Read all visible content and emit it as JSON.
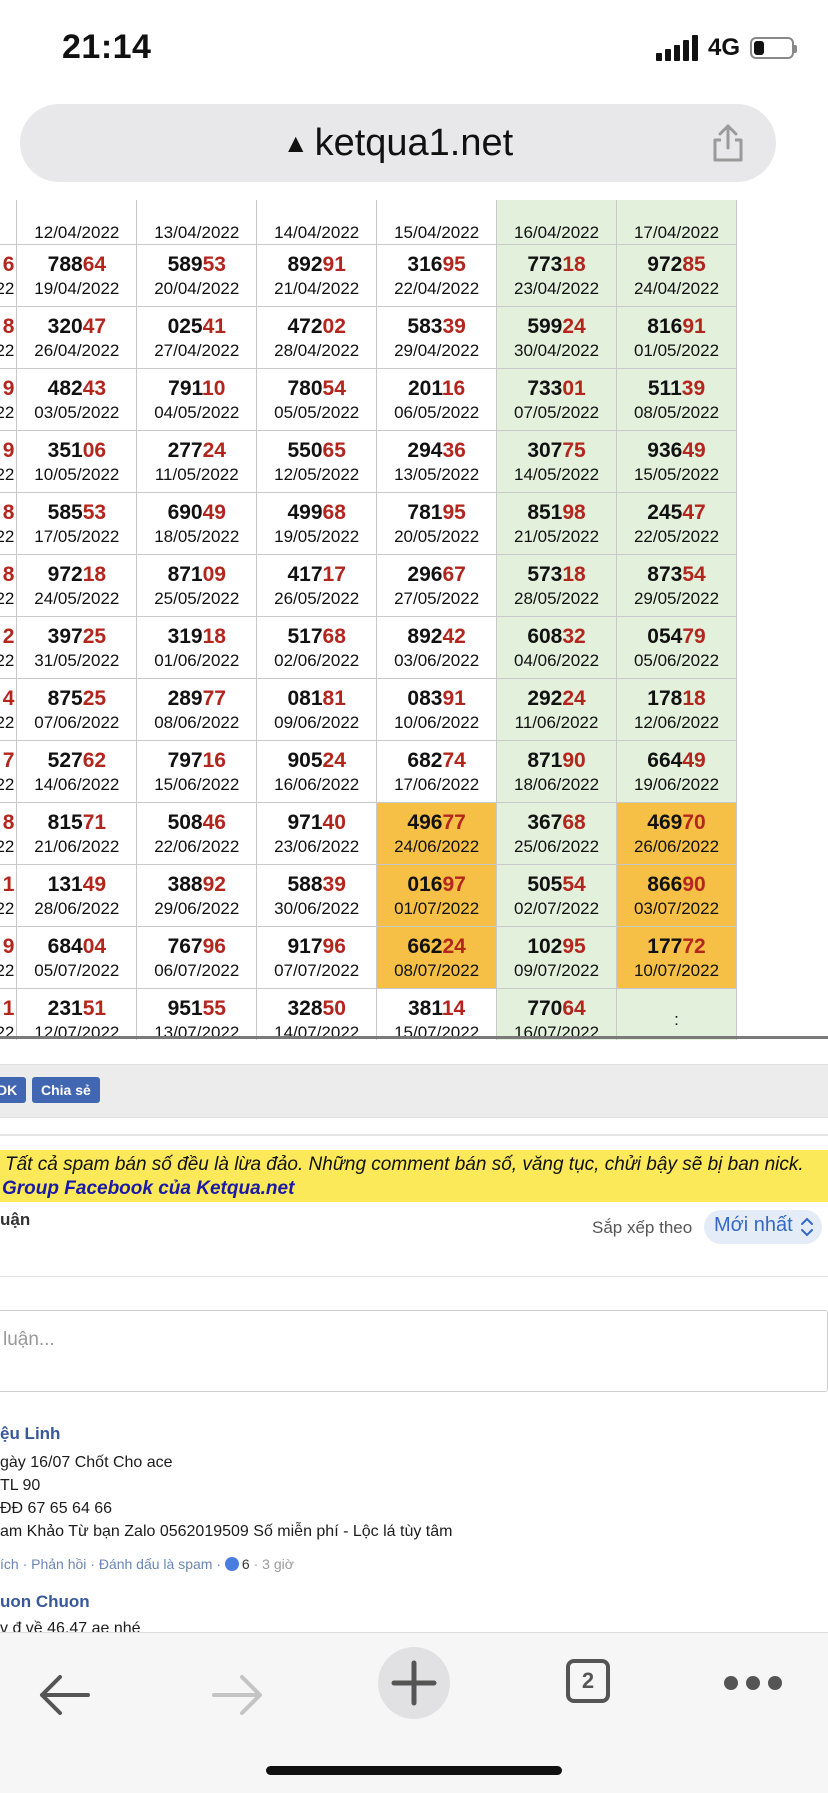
{
  "status_bar": {
    "time": "21:14",
    "network": "4G"
  },
  "browser": {
    "url": "ketqua1.net",
    "tab_count": "2"
  },
  "results_table": {
    "partial_top_dates": [
      "12/04/2022",
      "13/04/2022",
      "14/04/2022",
      "15/04/2022",
      "16/04/2022",
      "17/04/2022"
    ],
    "left_partial_tails": [
      "6",
      "8",
      "9",
      "9",
      "8",
      "8",
      "2",
      "4",
      "7",
      "8",
      "1",
      "9",
      "1"
    ],
    "left_partial_dates": [
      "022",
      "022",
      "022",
      "022",
      "022",
      "022",
      "022",
      "022",
      "022",
      "022",
      "022",
      "022",
      "022"
    ],
    "rows": [
      [
        {
          "head": "788",
          "tail": "64",
          "date": "19/04/2022"
        },
        {
          "head": "589",
          "tail": "53",
          "date": "20/04/2022"
        },
        {
          "head": "892",
          "tail": "91",
          "date": "21/04/2022"
        },
        {
          "head": "316",
          "tail": "95",
          "date": "22/04/2022"
        },
        {
          "head": "773",
          "tail": "18",
          "date": "23/04/2022"
        },
        {
          "head": "972",
          "tail": "85",
          "date": "24/04/2022"
        }
      ],
      [
        {
          "head": "320",
          "tail": "47",
          "date": "26/04/2022"
        },
        {
          "head": "025",
          "tail": "41",
          "date": "27/04/2022"
        },
        {
          "head": "472",
          "tail": "02",
          "date": "28/04/2022"
        },
        {
          "head": "583",
          "tail": "39",
          "date": "29/04/2022"
        },
        {
          "head": "599",
          "tail": "24",
          "date": "30/04/2022"
        },
        {
          "head": "816",
          "tail": "91",
          "date": "01/05/2022"
        }
      ],
      [
        {
          "head": "482",
          "tail": "43",
          "date": "03/05/2022"
        },
        {
          "head": "791",
          "tail": "10",
          "date": "04/05/2022"
        },
        {
          "head": "780",
          "tail": "54",
          "date": "05/05/2022"
        },
        {
          "head": "201",
          "tail": "16",
          "date": "06/05/2022"
        },
        {
          "head": "733",
          "tail": "01",
          "date": "07/05/2022"
        },
        {
          "head": "511",
          "tail": "39",
          "date": "08/05/2022"
        }
      ],
      [
        {
          "head": "351",
          "tail": "06",
          "date": "10/05/2022"
        },
        {
          "head": "277",
          "tail": "24",
          "date": "11/05/2022"
        },
        {
          "head": "550",
          "tail": "65",
          "date": "12/05/2022"
        },
        {
          "head": "294",
          "tail": "36",
          "date": "13/05/2022"
        },
        {
          "head": "307",
          "tail": "75",
          "date": "14/05/2022"
        },
        {
          "head": "936",
          "tail": "49",
          "date": "15/05/2022"
        }
      ],
      [
        {
          "head": "585",
          "tail": "53",
          "date": "17/05/2022"
        },
        {
          "head": "690",
          "tail": "49",
          "date": "18/05/2022"
        },
        {
          "head": "499",
          "tail": "68",
          "date": "19/05/2022"
        },
        {
          "head": "781",
          "tail": "95",
          "date": "20/05/2022"
        },
        {
          "head": "851",
          "tail": "98",
          "date": "21/05/2022"
        },
        {
          "head": "245",
          "tail": "47",
          "date": "22/05/2022"
        }
      ],
      [
        {
          "head": "972",
          "tail": "18",
          "date": "24/05/2022"
        },
        {
          "head": "871",
          "tail": "09",
          "date": "25/05/2022"
        },
        {
          "head": "417",
          "tail": "17",
          "date": "26/05/2022"
        },
        {
          "head": "296",
          "tail": "67",
          "date": "27/05/2022"
        },
        {
          "head": "573",
          "tail": "18",
          "date": "28/05/2022"
        },
        {
          "head": "873",
          "tail": "54",
          "date": "29/05/2022"
        }
      ],
      [
        {
          "head": "397",
          "tail": "25",
          "date": "31/05/2022"
        },
        {
          "head": "319",
          "tail": "18",
          "date": "01/06/2022"
        },
        {
          "head": "517",
          "tail": "68",
          "date": "02/06/2022"
        },
        {
          "head": "892",
          "tail": "42",
          "date": "03/06/2022"
        },
        {
          "head": "608",
          "tail": "32",
          "date": "04/06/2022"
        },
        {
          "head": "054",
          "tail": "79",
          "date": "05/06/2022"
        }
      ],
      [
        {
          "head": "875",
          "tail": "25",
          "date": "07/06/2022"
        },
        {
          "head": "289",
          "tail": "77",
          "date": "08/06/2022"
        },
        {
          "head": "081",
          "tail": "81",
          "date": "09/06/2022"
        },
        {
          "head": "083",
          "tail": "91",
          "date": "10/06/2022"
        },
        {
          "head": "292",
          "tail": "24",
          "date": "11/06/2022"
        },
        {
          "head": "178",
          "tail": "18",
          "date": "12/06/2022"
        }
      ],
      [
        {
          "head": "527",
          "tail": "62",
          "date": "14/06/2022"
        },
        {
          "head": "797",
          "tail": "16",
          "date": "15/06/2022"
        },
        {
          "head": "905",
          "tail": "24",
          "date": "16/06/2022"
        },
        {
          "head": "682",
          "tail": "74",
          "date": "17/06/2022"
        },
        {
          "head": "871",
          "tail": "90",
          "date": "18/06/2022"
        },
        {
          "head": "664",
          "tail": "49",
          "date": "19/06/2022"
        }
      ],
      [
        {
          "head": "815",
          "tail": "71",
          "date": "21/06/2022"
        },
        {
          "head": "508",
          "tail": "46",
          "date": "22/06/2022"
        },
        {
          "head": "971",
          "tail": "40",
          "date": "23/06/2022"
        },
        {
          "head": "496",
          "tail": "77",
          "date": "24/06/2022",
          "hl": true
        },
        {
          "head": "367",
          "tail": "68",
          "date": "25/06/2022"
        },
        {
          "head": "469",
          "tail": "70",
          "date": "26/06/2022",
          "hl": true
        }
      ],
      [
        {
          "head": "131",
          "tail": "49",
          "date": "28/06/2022"
        },
        {
          "head": "388",
          "tail": "92",
          "date": "29/06/2022"
        },
        {
          "head": "588",
          "tail": "39",
          "date": "30/06/2022"
        },
        {
          "head": "016",
          "tail": "97",
          "date": "01/07/2022",
          "hl": true
        },
        {
          "head": "505",
          "tail": "54",
          "date": "02/07/2022"
        },
        {
          "head": "866",
          "tail": "90",
          "date": "03/07/2022",
          "hl": true
        }
      ],
      [
        {
          "head": "684",
          "tail": "04",
          "date": "05/07/2022"
        },
        {
          "head": "767",
          "tail": "96",
          "date": "06/07/2022"
        },
        {
          "head": "917",
          "tail": "96",
          "date": "07/07/2022"
        },
        {
          "head": "662",
          "tail": "24",
          "date": "08/07/2022",
          "hl": true
        },
        {
          "head": "102",
          "tail": "95",
          "date": "09/07/2022"
        },
        {
          "head": "177",
          "tail": "72",
          "date": "10/07/2022",
          "hl": true
        }
      ],
      [
        {
          "head": "231",
          "tail": "51",
          "date": "12/07/2022"
        },
        {
          "head": "951",
          "tail": "55",
          "date": "13/07/2022"
        },
        {
          "head": "328",
          "tail": "50",
          "date": "14/07/2022"
        },
        {
          "head": "381",
          "tail": "14",
          "date": "15/07/2022"
        },
        {
          "head": "770",
          "tail": "64",
          "date": "16/07/2022"
        },
        {
          "head": "",
          "tail": "",
          "date": ":"
        }
      ]
    ]
  },
  "share": {
    "like_label": "DK",
    "share_label": "Chia sẻ"
  },
  "notice": {
    "line1": "Tất cả spam bán số đều là lừa đảo. Những comment bán số, văng tục, chửi bậy sẽ bị ban nick.",
    "line2": "Group Facebook của Ketqua.net"
  },
  "comments": {
    "title": "uận",
    "sort_label": "Sắp xếp theo",
    "sort_value": "Mới nhất",
    "input_placeholder": "luận...",
    "items": [
      {
        "author": "ệu Linh",
        "lines": [
          "gày 16/07 Chốt Cho ace",
          "TL 90",
          "ĐĐ 67 65 64 66",
          "am Khảo Từ bạn Zalo 0562019509 Số miễn phí - Lộc lá tùy tâm"
        ],
        "actions": "ích · Phản hồi · Đánh dấu là spam ·",
        "likes": "6",
        "time": "· 3 giờ"
      },
      {
        "author": "uon Chuon",
        "lines": [
          "v đ về 46,47 ae nhé"
        ]
      }
    ]
  },
  "colors": {
    "weekend_bg": "#e2f0dc",
    "highlight_bg": "#f5c045",
    "tail_red": "#b3261e",
    "link_blue": "#385898"
  },
  "icons": [
    "warning-icon",
    "share-icon",
    "back-arrow-icon",
    "forward-arrow-icon",
    "plus-icon",
    "tabs-icon",
    "more-icon"
  ]
}
